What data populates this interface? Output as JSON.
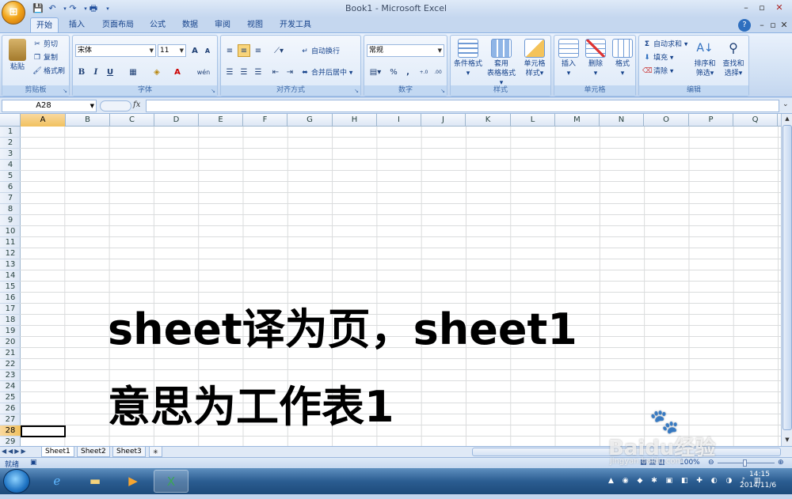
{
  "window": {
    "title": "Book1 - Microsoft Excel",
    "office_button_glyph": "⊞",
    "minimize": "–",
    "maximize": "▫",
    "close": "✕",
    "help": "?",
    "ribbon_min": "–",
    "ribbon_restore": "▫",
    "ribbon_close": "✕"
  },
  "tabs": [
    "开始",
    "插入",
    "页面布局",
    "公式",
    "数据",
    "审阅",
    "视图",
    "开发工具"
  ],
  "active_tab": "开始",
  "ribbon": {
    "clipboard": {
      "label": "剪贴板",
      "paste": "粘贴",
      "cut": "剪切",
      "copy": "复制",
      "format_painter": "格式刷"
    },
    "font": {
      "label": "字体",
      "font_name": "宋体",
      "font_size": "11",
      "bold": "B",
      "italic": "I",
      "underline": "U",
      "grow": "A",
      "shrink": "A",
      "phonetic": "wén"
    },
    "alignment": {
      "label": "对齐方式",
      "wrap_text": "自动换行",
      "merge_center": "合并后居中"
    },
    "number": {
      "label": "数字",
      "format": "常规",
      "percent": "%",
      "comma": ",",
      "inc_decimal": "+.0 .00",
      "dec_decimal": ".00 →.0"
    },
    "styles": {
      "label": "样式",
      "conditional": "条件格式",
      "table_line1": "套用",
      "table_line2": "表格格式",
      "cell_style_line1": "单元格",
      "cell_style_line2": "样式"
    },
    "cells": {
      "label": "单元格",
      "insert": "插入",
      "delete": "删除",
      "format": "格式"
    },
    "editing": {
      "label": "编辑",
      "autosum": "自动求和",
      "fill": "填充",
      "clear": "清除",
      "sort_line1": "排序和",
      "sort_line2": "筛选",
      "find_line1": "查找和",
      "find_line2": "选择"
    }
  },
  "formula_bar": {
    "name_box": "A28",
    "fx": "fx",
    "formula": ""
  },
  "columns": [
    "A",
    "B",
    "C",
    "D",
    "E",
    "F",
    "G",
    "H",
    "I",
    "J",
    "K",
    "L",
    "M",
    "N",
    "O",
    "P",
    "Q"
  ],
  "selected_column": "A",
  "rows": [
    "1",
    "2",
    "3",
    "4",
    "5",
    "6",
    "7",
    "8",
    "9",
    "10",
    "11",
    "12",
    "13",
    "14",
    "15",
    "16",
    "17",
    "18",
    "19",
    "20",
    "21",
    "22",
    "23",
    "24",
    "25",
    "26",
    "27",
    "28",
    "29"
  ],
  "selected_row": "28",
  "overlay_text": {
    "line1": "sheet译为页，sheet1",
    "line2": "意思为工作表1"
  },
  "sheets": [
    "Sheet1",
    "Sheet2",
    "Sheet3"
  ],
  "active_sheet": "Sheet1",
  "status": {
    "ready": "就绪",
    "zoom": "100%"
  },
  "taskbar": {
    "time": "14:15",
    "date": "2014/11/6"
  },
  "watermark": {
    "brand": "Baidu经验",
    "url": "jingyan.baidu.com"
  }
}
